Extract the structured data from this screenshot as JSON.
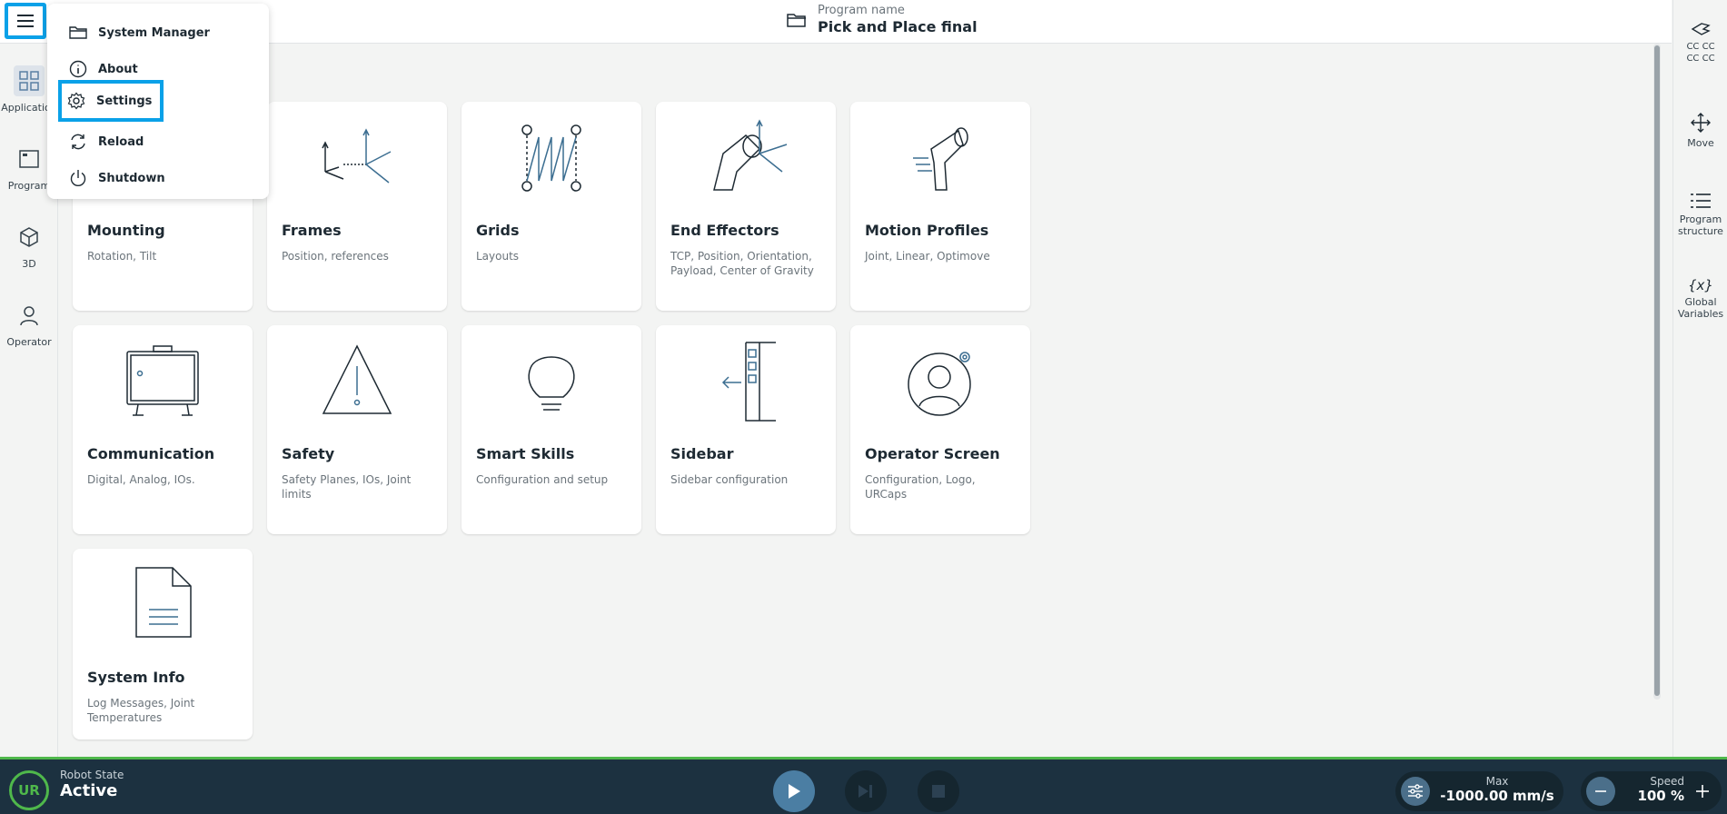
{
  "header": {
    "program_name_label": "Program name",
    "program_name_value": "Pick and Place final"
  },
  "left_rail": {
    "items": [
      {
        "label": "Application",
        "icon": "grid-icon"
      },
      {
        "label": "Program",
        "icon": "program-icon"
      },
      {
        "label": "3D",
        "icon": "cube-icon"
      },
      {
        "label": "Operator",
        "icon": "person-icon"
      }
    ]
  },
  "menu": {
    "items": [
      {
        "label": "System Manager",
        "icon": "folder-icon"
      },
      {
        "label": "About",
        "icon": "info-icon"
      },
      {
        "label": "Settings",
        "icon": "gear-icon"
      },
      {
        "label": "Reload",
        "icon": "reload-icon"
      },
      {
        "label": "Shutdown",
        "icon": "power-icon"
      }
    ]
  },
  "cards": [
    {
      "title": "Mounting",
      "subtitle": "Rotation, Tilt"
    },
    {
      "title": "Frames",
      "subtitle": "Position, references"
    },
    {
      "title": "Grids",
      "subtitle": "Layouts"
    },
    {
      "title": "End Effectors",
      "subtitle": "TCP, Position, Orientation, Payload, Center of Gravity"
    },
    {
      "title": "Motion Profiles",
      "subtitle": "Joint, Linear, Optimove"
    },
    {
      "title": "Communication",
      "subtitle": "Digital, Analog, IOs."
    },
    {
      "title": "Safety",
      "subtitle": "Safety Planes, IOs, Joint limits"
    },
    {
      "title": "Smart Skills",
      "subtitle": "Configuration and setup"
    },
    {
      "title": "Sidebar",
      "subtitle": "Sidebar configuration"
    },
    {
      "title": "Operator Screen",
      "subtitle": "Configuration, Logo, URCaps"
    },
    {
      "title": "System Info",
      "subtitle": "Log Messages, Joint Temperatures"
    }
  ],
  "right_rail": {
    "items": [
      {
        "label": "CC CC\nCC CC",
        "icon": "gripper-icon"
      },
      {
        "label": "Move",
        "icon": "move-icon"
      },
      {
        "label": "Program structure",
        "icon": "list-icon"
      },
      {
        "label": "Global Variables",
        "icon": "variable-icon"
      }
    ],
    "var_glyph": "{x}"
  },
  "bottom": {
    "logo_text": "UR",
    "robot_state_label": "Robot State",
    "robot_state_value": "Active",
    "max_label": "Max",
    "max_value": "-1000.00 mm/s",
    "speed_label": "Speed",
    "speed_value": "100 %"
  },
  "colors": {
    "highlight": "#0aa1e8",
    "bottom_bar": "#1c3140",
    "accent_green": "#4fb84b"
  }
}
